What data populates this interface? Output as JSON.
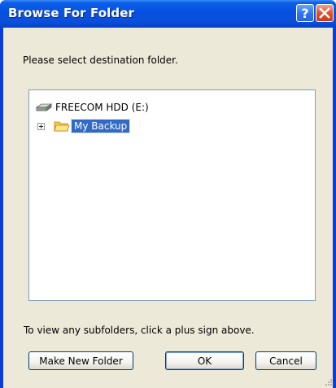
{
  "window": {
    "title": "Browse For Folder",
    "help_button": "?",
    "close_button": "X"
  },
  "prompt": "Please select destination folder.",
  "tree": {
    "drive": {
      "label": "FREECOM HDD (E:)",
      "icon": "drive-icon"
    },
    "folder": {
      "label": "My Backup",
      "icon": "folder-icon",
      "selected": true,
      "expandable": true
    }
  },
  "hint": "To view any subfolders, click a plus sign above.",
  "buttons": {
    "make_new_folder": "Make New Folder",
    "ok": "OK",
    "cancel": "Cancel"
  },
  "colors": {
    "titlebar": "#0851e0",
    "dialog_bg": "#ece9d8",
    "selection": "#316ac5"
  }
}
